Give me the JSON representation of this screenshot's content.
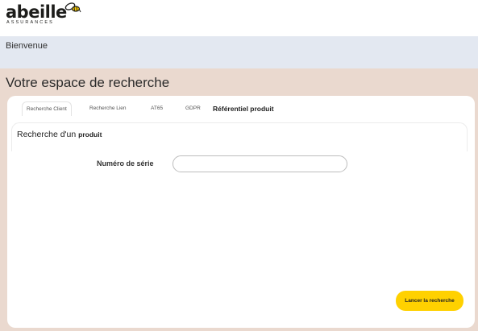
{
  "brand": {
    "name": "abeille",
    "subtitle": "ASSURANCES"
  },
  "welcome": {
    "text": "Bienvenue"
  },
  "page": {
    "title": "Votre espace de recherche"
  },
  "tabs": [
    {
      "label": "Recherche Client"
    },
    {
      "label": "Recherche Lien"
    },
    {
      "label": "AT65"
    },
    {
      "label": "GDPR"
    },
    {
      "label": "Référentiel produit"
    }
  ],
  "section": {
    "title_prefix": "Recherche d'un",
    "title_strong": "produit"
  },
  "form": {
    "serial_label": "Numéro de série",
    "serial_value": "",
    "serial_placeholder": ""
  },
  "actions": {
    "search_label": "Lancer la recherche"
  },
  "colors": {
    "accent": "#ffd100",
    "welcome_bg": "#e3e8f1",
    "main_bg": "#ead9cf"
  }
}
